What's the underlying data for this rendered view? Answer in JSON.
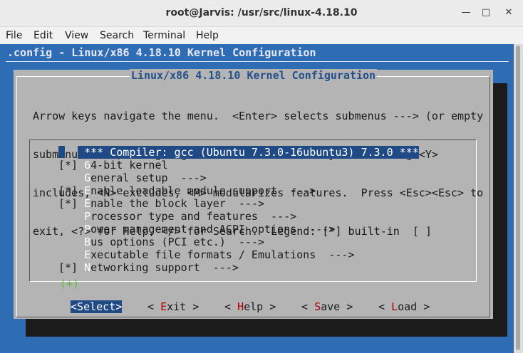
{
  "window": {
    "title": "root@Jarvis: /usr/src/linux-4.18.10"
  },
  "menubar": [
    "File",
    "Edit",
    "View",
    "Search",
    "Terminal",
    "Help"
  ],
  "term": {
    "header": ".config - Linux/x86 4.18.10 Kernel Configuration",
    "dialog_title": "Linux/x86 4.18.10 Kernel Configuration",
    "help_lines": [
      "Arrow keys navigate the menu.  <Enter> selects submenus ---> (or empty",
      "submenus ----).  Highlighted letters are hotkeys.  Pressing <Y>",
      "includes, <N> excludes, <M> modularizes features.  Press <Esc><Esc> to",
      "exit, <?> for Help, </> for Search.  Legend: [*] built-in  [ ]"
    ],
    "items": [
      {
        "prefix": "   ",
        "hk": "",
        "rest": " *** Compiler: gcc (Ubuntu 7.3.0-16ubuntu3) 7.3.0 ***",
        "selected": true
      },
      {
        "prefix": "[*] ",
        "hk": "6",
        "rest": "4-bit kernel"
      },
      {
        "prefix": "    ",
        "hk": "G",
        "rest": "eneral setup  --->"
      },
      {
        "prefix": "[*] ",
        "hk": "E",
        "rest": "nable loadable module support  --->"
      },
      {
        "prefix": "[*] ",
        "hk": "E",
        "rest": "nable the block layer  --->"
      },
      {
        "prefix": "    ",
        "hk": "P",
        "rest": "rocessor type and features  --->"
      },
      {
        "prefix": "    ",
        "hk": "P",
        "rest": "ower management and ACPI options  --->"
      },
      {
        "prefix": "    ",
        "hk": "B",
        "rest": "us options (PCI etc.)  --->"
      },
      {
        "prefix": "    ",
        "hk": "E",
        "rest": "xecutable file formats / Emulations  --->"
      },
      {
        "prefix": "[*] ",
        "hk": "N",
        "rest": "etworking support  --->"
      }
    ],
    "more_indicator": "(+)",
    "buttons": [
      {
        "open": "<",
        "hk": "S",
        "rest": "elect",
        "close": ">"
      },
      {
        "open": "< ",
        "hk": "E",
        "rest": "xit",
        "close": " >"
      },
      {
        "open": "< ",
        "hk": "H",
        "rest": "elp",
        "close": " >"
      },
      {
        "open": "< ",
        "hk": "S",
        "rest": "ave",
        "close": " >"
      },
      {
        "open": "< ",
        "hk": "L",
        "rest": "oad",
        "close": " >"
      }
    ]
  }
}
